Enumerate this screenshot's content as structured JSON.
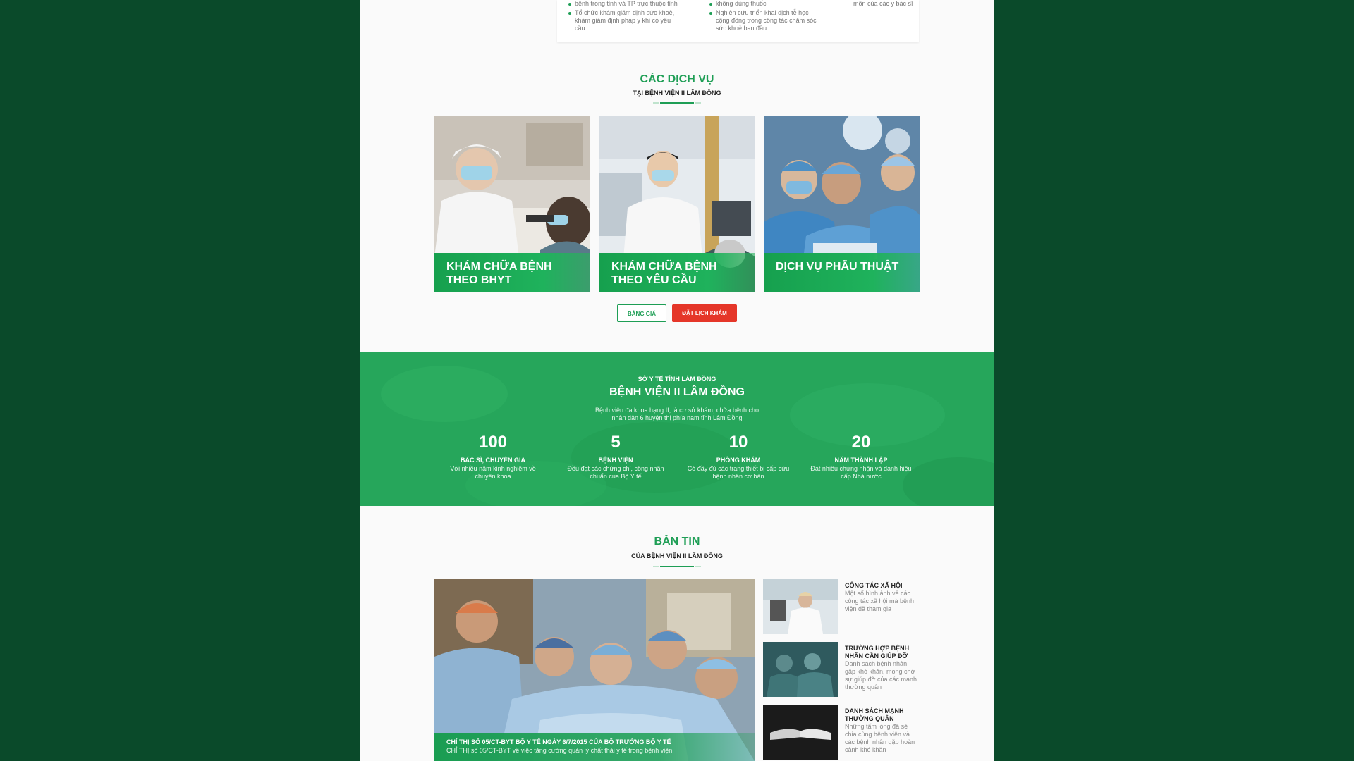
{
  "top_card": {
    "col1": [
      "bệnh trong tỉnh và TP trực thuộc tỉnh",
      "Tổ chức khám giám định sức khoẻ, khám giám định pháp y khi có yêu cầu"
    ],
    "col2": [
      "không dùng thuốc",
      "Nghiên cứu triển khai dịch tễ học cộng đồng trong công tác chăm sóc sức khoẻ ban đầu"
    ],
    "col3": [
      "môn của các y bác sĩ"
    ]
  },
  "services": {
    "title": "CÁC DỊCH VỤ",
    "subtitle": "TẠI BỆNH VIỆN II LÂM ĐỒNG",
    "items": [
      {
        "label": "KHÁM CHỮA BỆNH THEO BHYT"
      },
      {
        "label": "KHÁM CHỮA BỆNH THEO YÊU CẦU"
      },
      {
        "label": "DỊCH VỤ PHẪU THUẬT"
      }
    ],
    "btn_price": "BẢNG GIÁ",
    "btn_book": "ĐẶT LỊCH KHÁM"
  },
  "band": {
    "eyebrow": "SỞ Y TẾ TỈNH LÂM ĐỒNG",
    "title": "BỆNH VIỆN II LÂM ĐỒNG",
    "desc": "Bệnh viện đa khoa hạng II, là cơ sở khám, chữa bệnh cho nhân dân 6 huyện thị phía nam tỉnh Lâm Đồng",
    "stats": [
      {
        "number": "100",
        "label": "BÁC SĨ, CHUYÊN GIA",
        "desc": "Với nhiều năm kinh nghiệm về chuyên khoa"
      },
      {
        "number": "5",
        "label": "BỆNH VIỆN",
        "desc": "Đều đạt các chứng chỉ, công nhận chuẩn của Bộ Y tế"
      },
      {
        "number": "10",
        "label": "PHÒNG KHÁM",
        "desc": "Có đầy đủ các trang thiết bị cấp cứu bệnh nhân cơ bản"
      },
      {
        "number": "20",
        "label": "NĂM THÀNH LẬP",
        "desc": "Đạt nhiều chứng nhận và danh hiệu cấp Nhà nước"
      }
    ]
  },
  "news": {
    "title": "BẢN TIN",
    "subtitle": "CỦA BỆNH VIỆN II LÂM ĐỒNG",
    "main": {
      "headline": "CHỈ THỊ SỐ 05/CT-BYT BỘ Y TẾ NGÀY 6/7/2015 CỦA BỘ TRƯỞNG BỘ Y TẾ",
      "summary": "CHỈ THỊ số 05/CT-BYT về việc tăng cường quản lý chất thải y tế trong bệnh viện"
    },
    "items": [
      {
        "title": "CÔNG TÁC XÃ HỘI",
        "desc": "Một số hình ảnh về các công tác xã hội mà bệnh viện đã tham gia"
      },
      {
        "title": "TRƯỜNG HỢP BỆNH NHÂN CẦN GIÚP ĐỠ",
        "desc": "Danh sách bệnh nhân gặp khó khăn, mong chờ sự giúp đỡ của các mạnh thường quân"
      },
      {
        "title": "DANH SÁCH MẠNH THƯỜNG QUÂN",
        "desc": "Những tấm lòng đã sẻ chia cùng bệnh viện và các bệnh nhân gặp hoàn cảnh khó khăn"
      }
    ]
  }
}
